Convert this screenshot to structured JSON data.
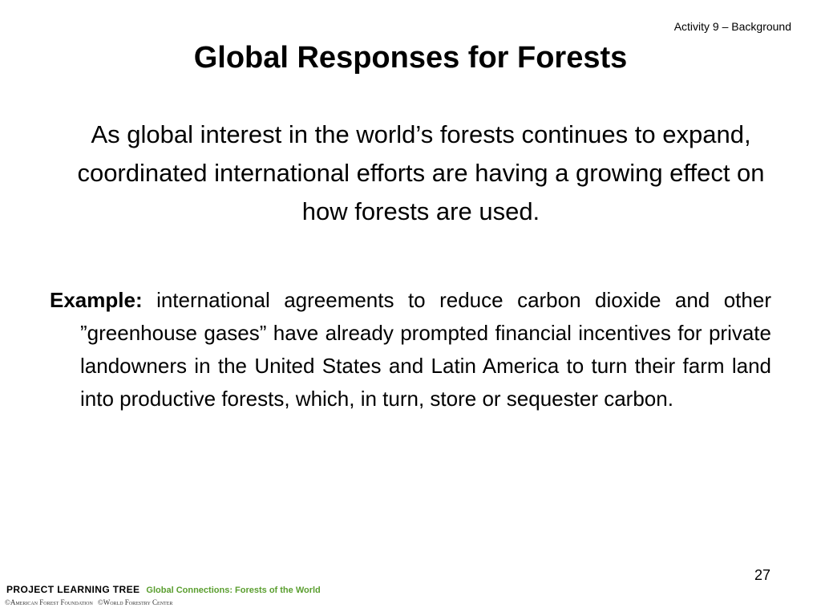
{
  "header": {
    "activity_label": "Activity 9 – Background",
    "title": "Global Responses for Forests"
  },
  "content": {
    "intro": "As global interest in the world’s forests continues to expand, coordinated international efforts are having a growing effect on how forests are used.",
    "example_label": "Example:",
    "example_text": " international agreements to reduce carbon dioxide and other ”greenhouse gases” have already prompted financial incentives for private landowners in the United States and Latin America to turn their farm land into productive forests, which, in turn, store or sequester carbon."
  },
  "footer": {
    "page_number": "27",
    "brand": "PROJECT LEARNING TREE",
    "tagline": "Global Connections: Forests of the World",
    "credit_1": "©American Forest Foundation",
    "credit_2": "©World Forestry Center"
  },
  "colors": {
    "background": "#ffffff",
    "text": "#000000",
    "tagline_green": "#5a9e2f"
  }
}
